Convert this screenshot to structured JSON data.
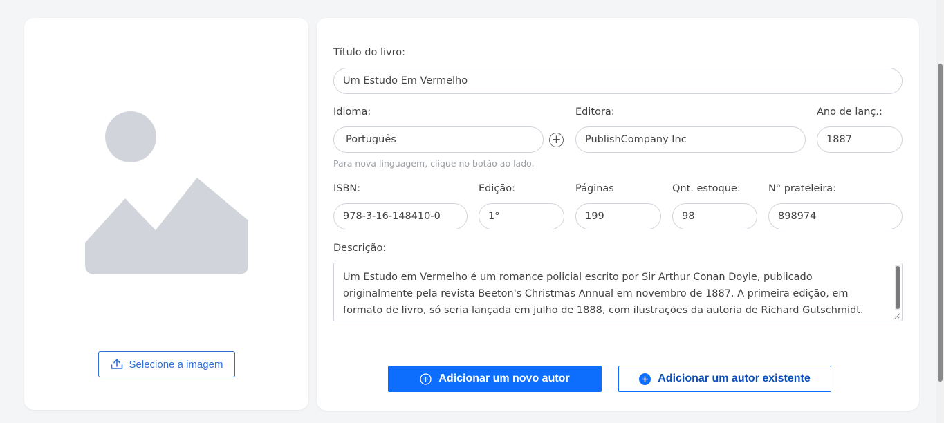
{
  "image_panel": {
    "upload_label": "Selecione a imagem"
  },
  "form": {
    "title": {
      "label": "Título do livro:",
      "value": "Um Estudo Em Vermelho"
    },
    "language": {
      "label": "Idioma:",
      "value": "Português",
      "hint": "Para nova linguagem, clique no botão ao lado."
    },
    "publisher": {
      "label": "Editora:",
      "value": "PublishCompany Inc"
    },
    "year": {
      "label": "Ano de lanç.:",
      "value": "1887"
    },
    "isbn": {
      "label": "ISBN:",
      "value": "978-3-16-148410-0"
    },
    "edition": {
      "label": "Edição:",
      "value": "1°"
    },
    "pages": {
      "label": "Páginas",
      "value": "199"
    },
    "stock": {
      "label": "Qnt. estoque:",
      "value": "98"
    },
    "shelf": {
      "label": "N° prateleira:",
      "value": "898974"
    },
    "description": {
      "label": "Descrição:",
      "value": "Um Estudo em Vermelho é um romance policial escrito por Sir Arthur Conan Doyle, publicado originalmente pela revista Beeton's Christmas Annual em novembro de 1887. A primeira edição, em formato de livro, só seria lançada em julho de 1888, com ilustrações da autoria de Richard Gutschmidt."
    }
  },
  "actions": {
    "add_new_author": "Adicionar um novo autor",
    "add_existing_author": "Adicionar um autor existente"
  },
  "colors": {
    "primary": "#0d6efd",
    "upload_accent": "#2f6fd6",
    "placeholder_gray": "#d1d5db",
    "background": "#f4f5f7"
  },
  "icons": {
    "placeholder": "image-placeholder-icon",
    "upload": "upload-icon",
    "add_language": "plus-circle-icon",
    "add_new_author": "plus-circle-outline-icon",
    "add_existing_author": "plus-circle-filled-icon"
  }
}
